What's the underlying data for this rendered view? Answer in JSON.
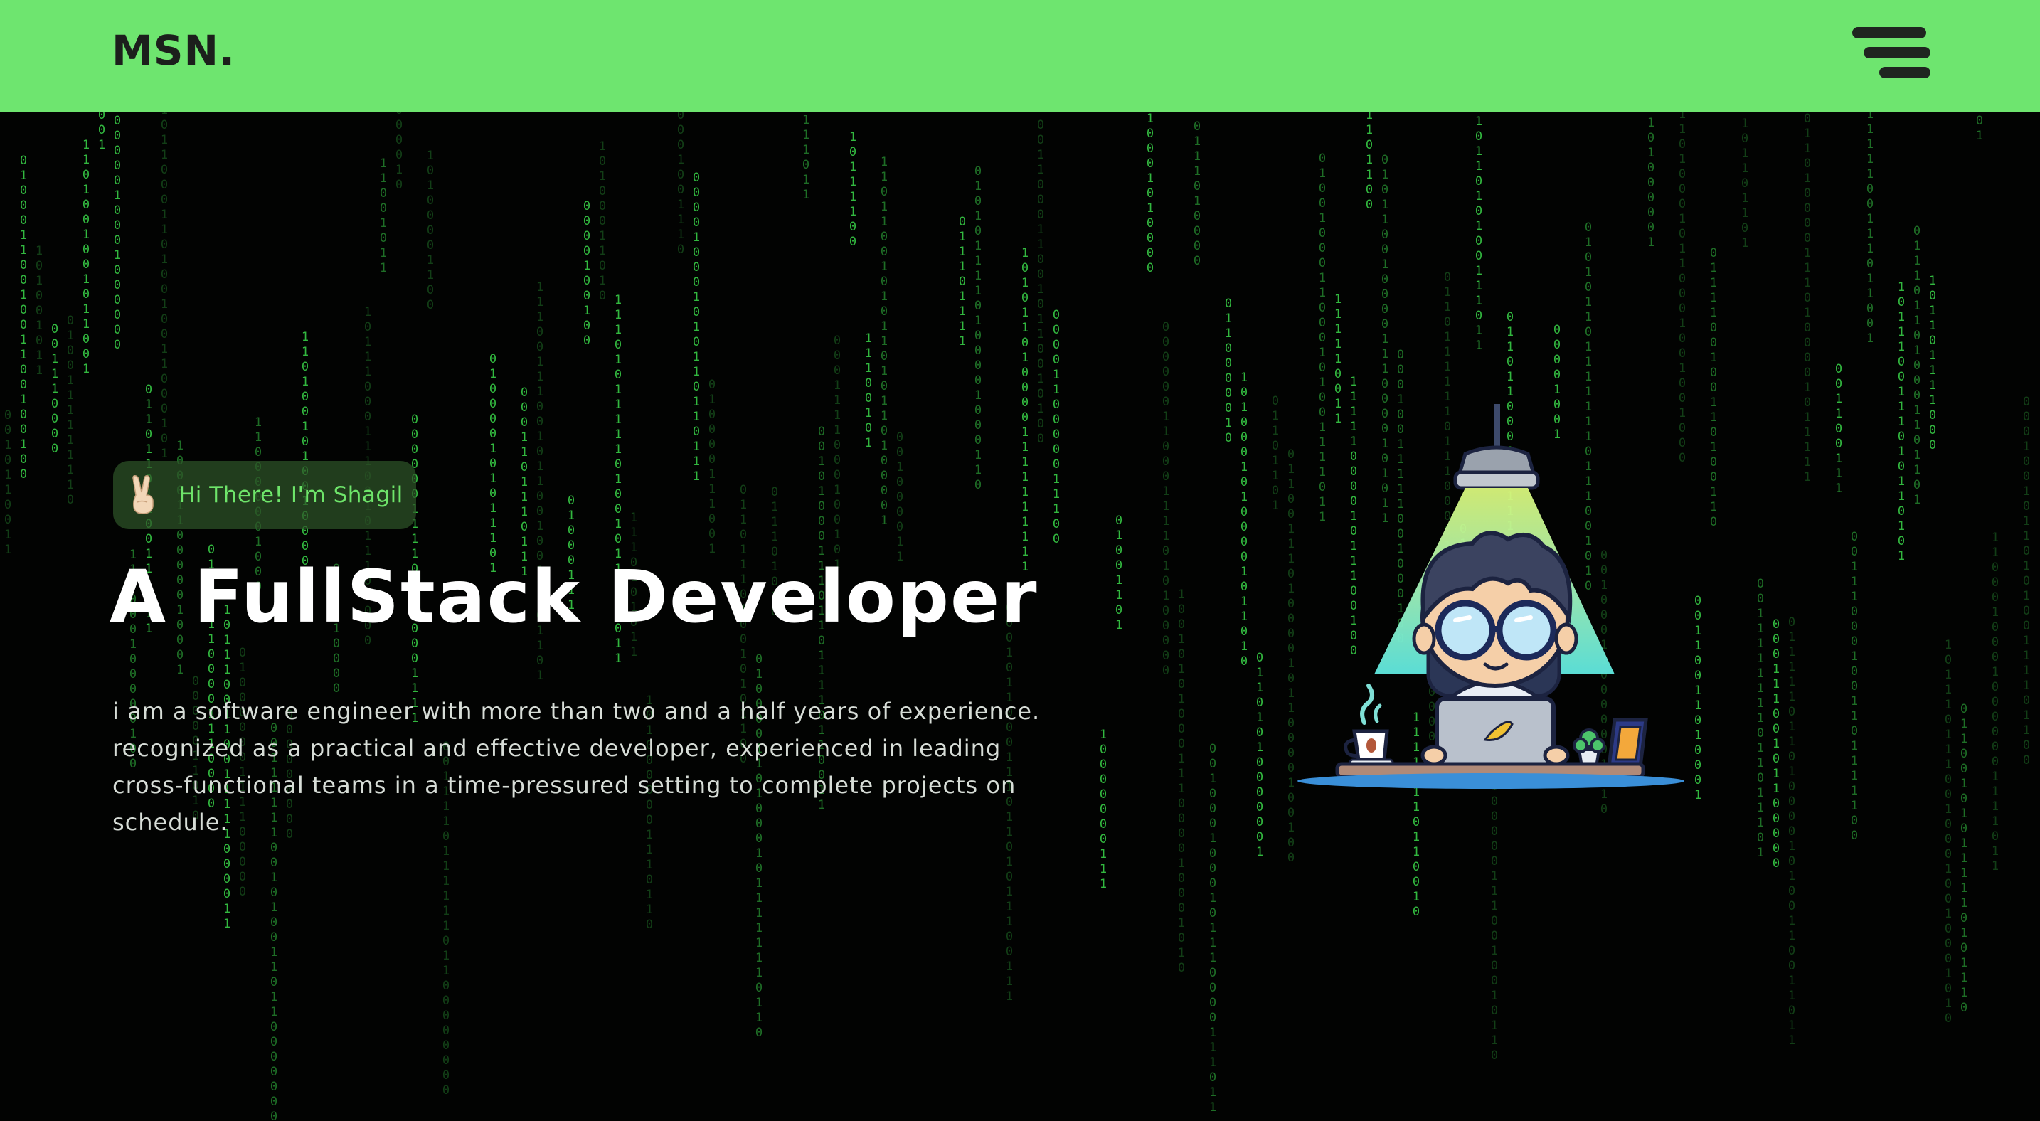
{
  "header": {
    "logo": "MSN.",
    "background_color": "#6ee56f",
    "menu_icon": "hamburger-menu-icon"
  },
  "hero": {
    "greeting_icon": "victory-hand-emoji",
    "greeting": "Hi There! I'm Shagil",
    "title": "A FullStack Developer",
    "description": "i am a software engineer with more than two and a half years of experience. recognized as a practical and effective developer, experienced in leading cross-functional teams in a time-pressured setting to complete projects on schedule.",
    "illustration": "developer-at-laptop-under-lamp-illustration"
  },
  "theme": {
    "background": "#020302",
    "rain_color": "#3bd84a",
    "accent": "#6ee56f"
  }
}
